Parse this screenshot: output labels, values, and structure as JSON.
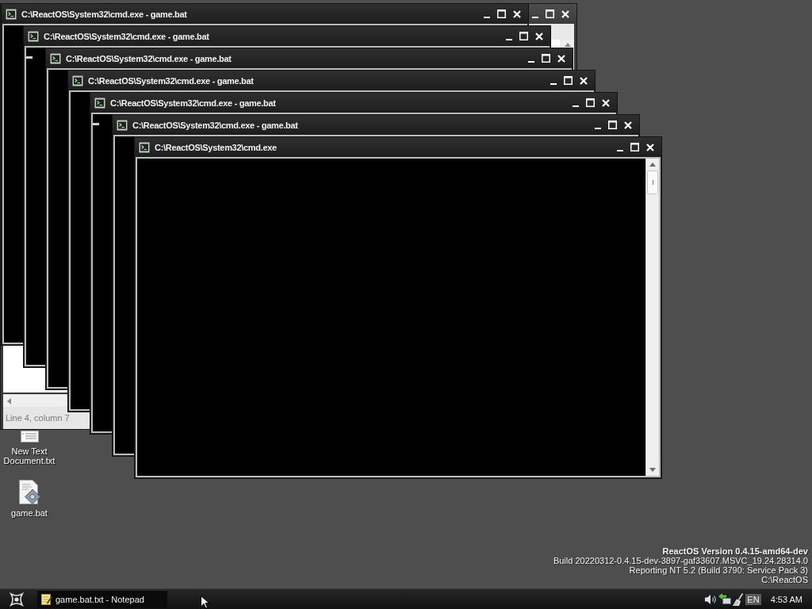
{
  "desktop_icons": [
    {
      "label": "New Text Document.txt",
      "kind": "text_document"
    },
    {
      "label": "game.bat",
      "kind": "batch_file"
    }
  ],
  "notepad": {
    "status": "Line 4, column 7"
  },
  "console_windows": [
    {
      "title": "C:\\ReactOS\\System32\\cmd.exe - game.bat",
      "kind": "blank"
    },
    {
      "title": "C:\\ReactOS\\System32\\cmd.exe - game.bat",
      "kind": "cursor"
    },
    {
      "title": "C:\\ReactOS\\System32\\cmd.exe - game.bat",
      "kind": "blank"
    },
    {
      "title": "C:\\ReactOS\\System32\\cmd.exe - game.bat",
      "kind": "blank"
    },
    {
      "title": "C:\\ReactOS\\System32\\cmd.exe - game.bat",
      "kind": "cursor"
    },
    {
      "title": "C:\\ReactOS\\System32\\cmd.exe - game.bat",
      "kind": "blank"
    },
    {
      "title": "C:\\ReactOS\\System32\\cmd.exe",
      "kind": "blank"
    }
  ],
  "version_info": [
    {
      "text": "ReactOS Version 0.4.15-amd64-dev",
      "kind": "heading"
    },
    {
      "text": "Build 20220312-0.4.15-dev-3897-gaf33607.MSVC_19.24.28314.0",
      "kind": "line"
    },
    {
      "text": "Reporting NT 5.2 (Build 3790: Service Pack 3)",
      "kind": "line"
    },
    {
      "text": "C:\\ReactOS",
      "kind": "line"
    }
  ],
  "taskbar": {
    "tasks": [
      {
        "label": "game.bat.txt - Notepad",
        "selected": false
      }
    ],
    "tray": {
      "language": "EN",
      "clock": "4:53 AM"
    }
  }
}
